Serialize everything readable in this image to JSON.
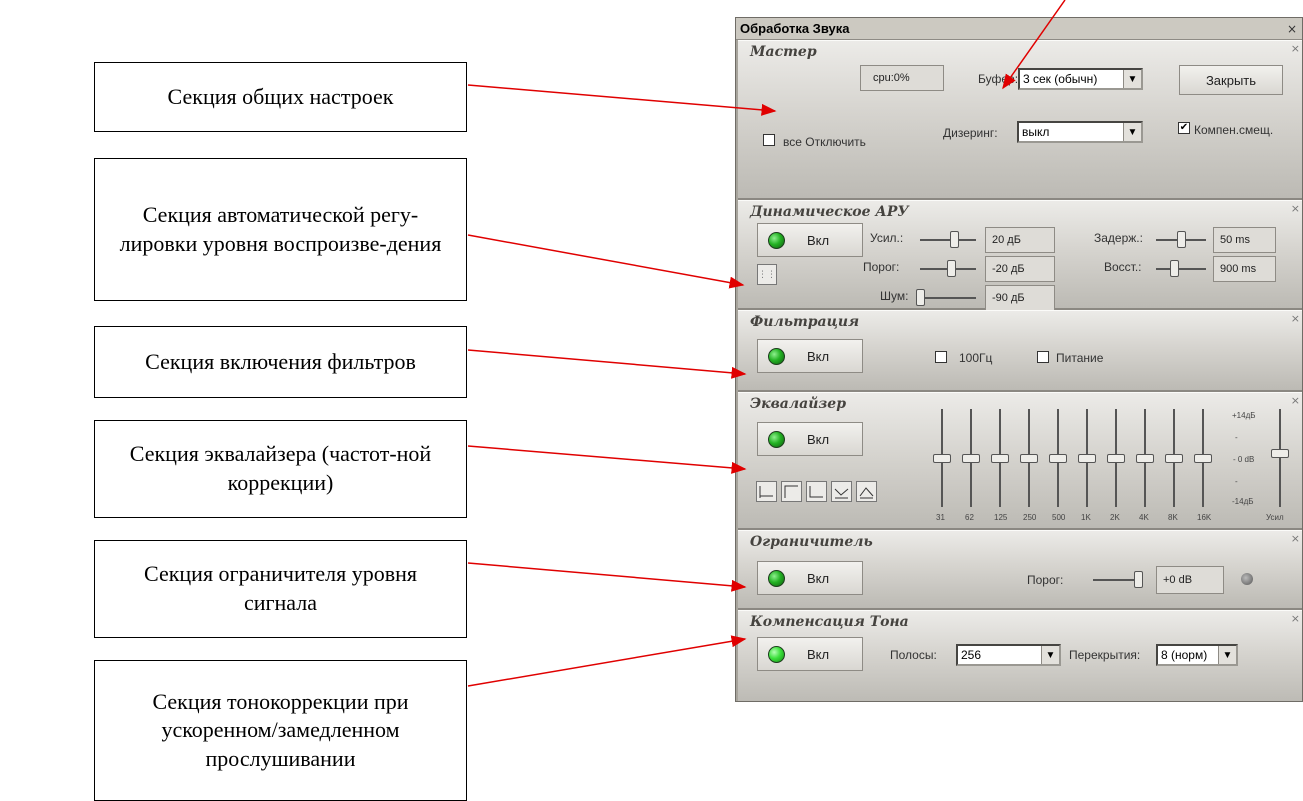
{
  "annotations": {
    "general": "Секция общих настроек",
    "agc": "Секция автоматической регу-лировки уровня воспроизве-дения",
    "filters": "Секция включения фильтров",
    "eq": "Секция эквалайзера (частот-ной коррекции)",
    "limiter": "Секция ограничителя уровня сигнала",
    "tone": "Секция тонокоррекции при ускоренном/замедленном прослушивании"
  },
  "window": {
    "title": "Обработка Звука",
    "close_glyph": "×"
  },
  "master": {
    "title": "Мастер",
    "cpu": "cpu:0%",
    "buffer_label": "Буфер:",
    "buffer_value": "3 сек (обычн)",
    "close_button": "Закрыть",
    "disable_all_label": "все Отключить",
    "disable_all_checked": false,
    "dither_label": "Дизеринг:",
    "dither_value": "выкл",
    "dc_comp_label": "Компен.смещ.",
    "dc_comp_checked": true
  },
  "agc": {
    "title": "Динамическое АРУ",
    "on_label": "Вкл",
    "gain_label": "Усил.:",
    "gain_value": "20 дБ",
    "gain_level": 0.6,
    "threshold_label": "Порог:",
    "threshold_value": "-20 дБ",
    "threshold_level": 0.55,
    "noise_label": "Шум:",
    "noise_value": "-90 дБ",
    "noise_level": 0.0,
    "delay_label": "Задерж.:",
    "delay_value": "50 ms",
    "delay_level": 0.5,
    "recovery_label": "Восст.:",
    "recovery_value": "900 ms",
    "recovery_level": 0.35
  },
  "filters": {
    "title": "Фильтрация",
    "on_label": "Вкл",
    "hz100_label": "100Гц",
    "hz100_checked": false,
    "power_label": "Питание",
    "power_checked": false
  },
  "eq": {
    "title": "Эквалайзер",
    "on_label": "Вкл",
    "bands": [
      "31",
      "62",
      "125",
      "250",
      "500",
      "1K",
      "2K",
      "4K",
      "8K",
      "16K"
    ],
    "band_levels": [
      0.5,
      0.5,
      0.5,
      0.5,
      0.5,
      0.5,
      0.5,
      0.5,
      0.5,
      0.5
    ],
    "scale_top": "+14дБ",
    "scale_mid": "- 0 dB",
    "scale_bottom": "-14дБ",
    "scale_dash": "-",
    "gain_label": "Усил",
    "gain_level": 0.55
  },
  "limiter": {
    "title": "Ограничитель",
    "on_label": "Вкл",
    "threshold_label": "Порог:",
    "threshold_value": "+0 dB",
    "threshold_level": 0.9
  },
  "tone": {
    "title": "Компенсация Тона",
    "on_label": "Вкл",
    "bands_label": "Полосы:",
    "bands_value": "256",
    "overlap_label": "Перекрытия:",
    "overlap_value": "8 (норм)"
  }
}
